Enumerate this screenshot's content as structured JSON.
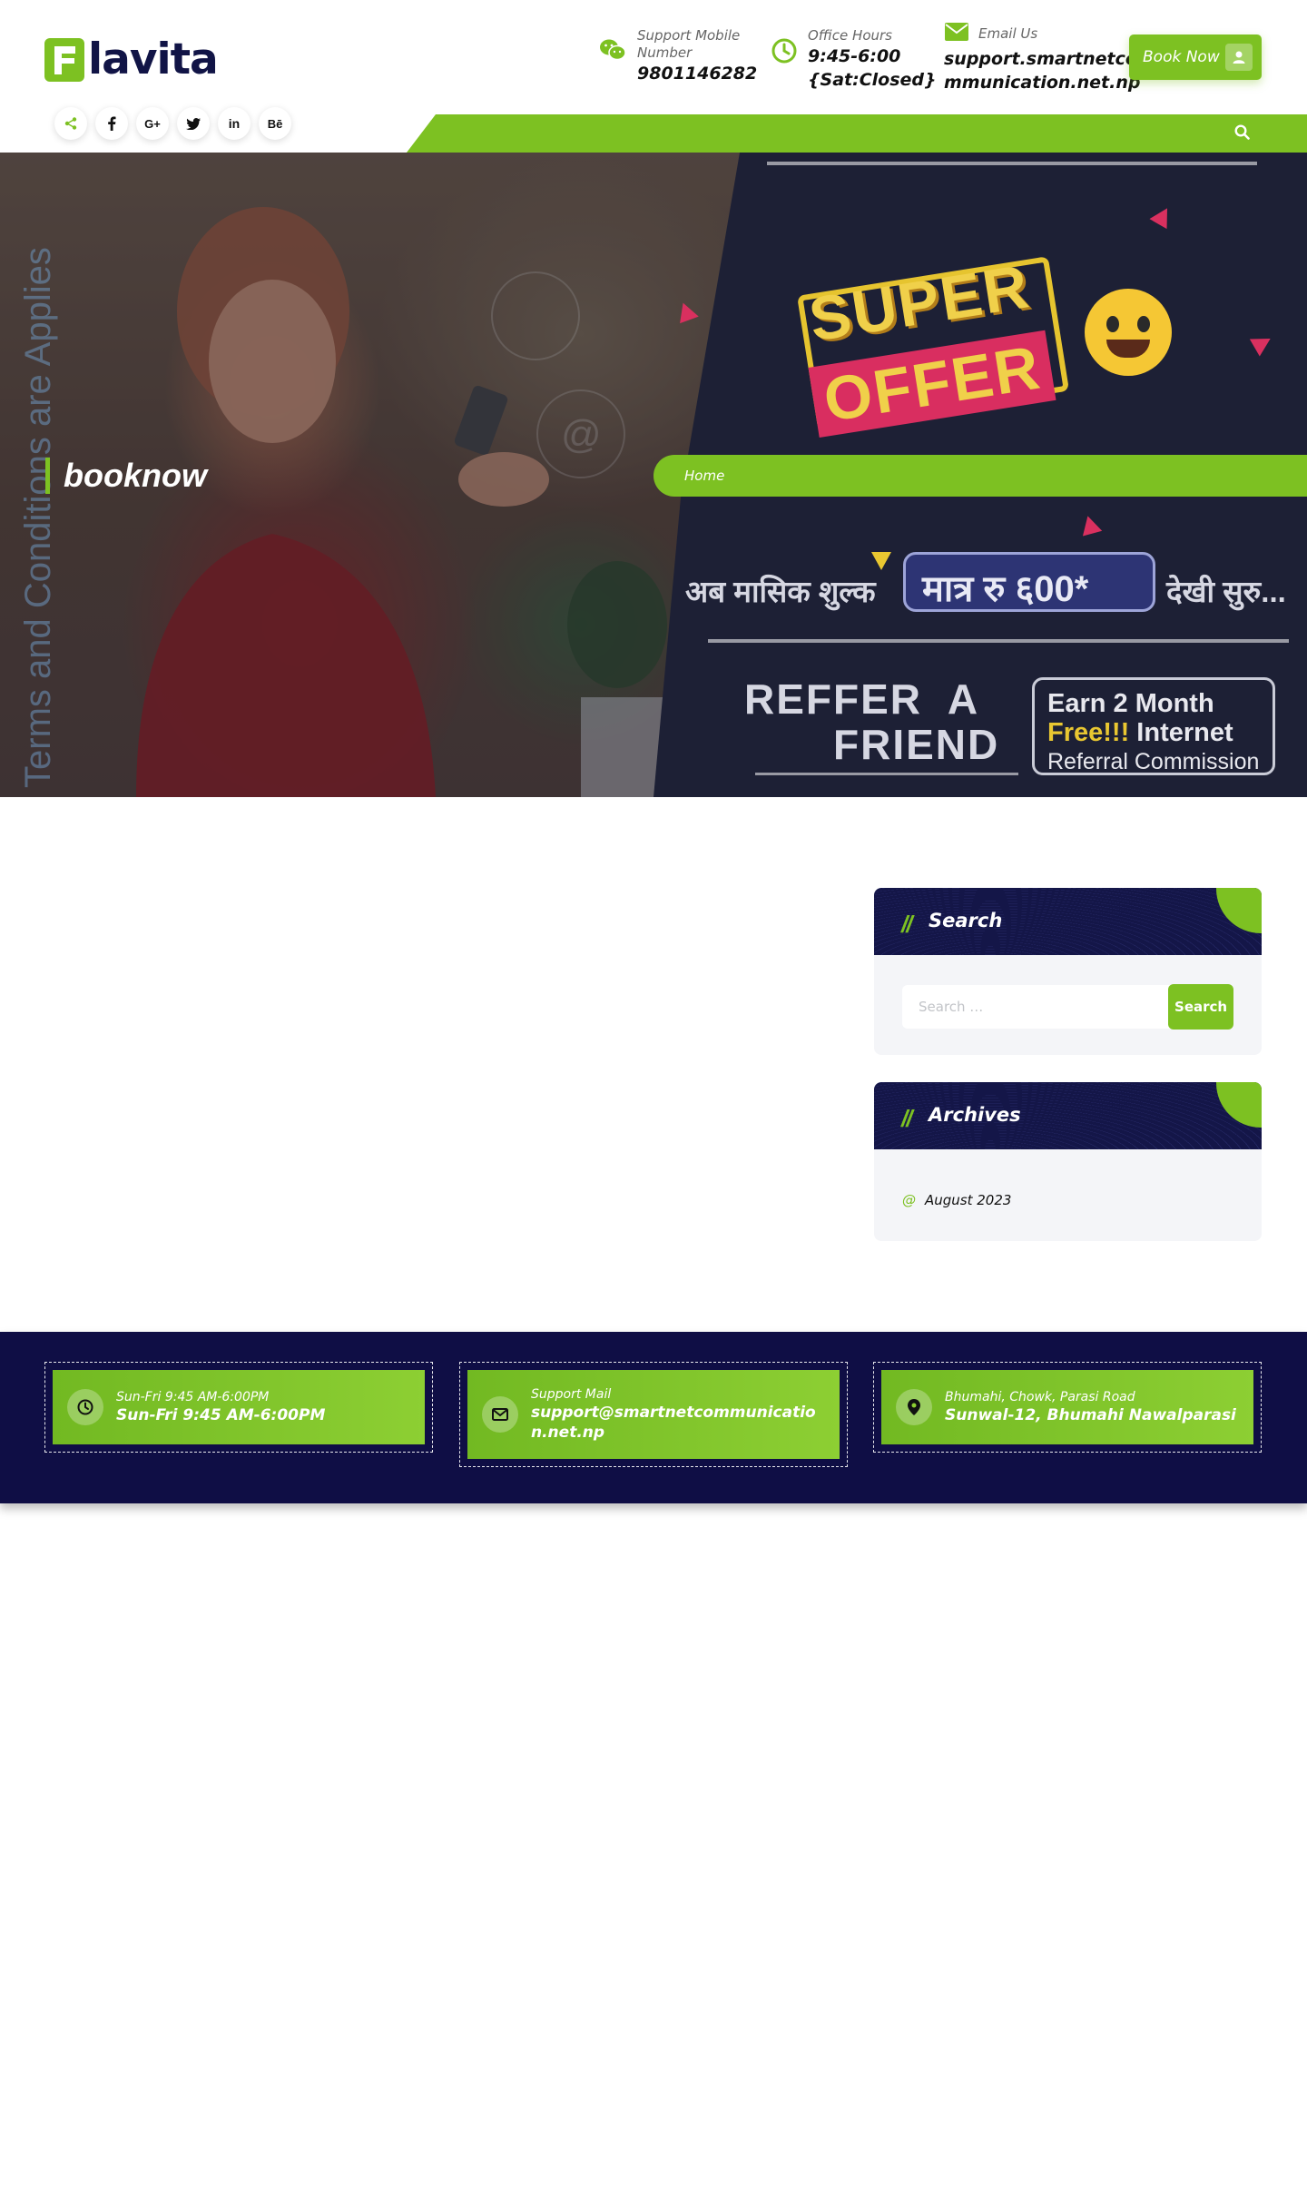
{
  "brand": {
    "name": "lavita",
    "accent": "#7dc122",
    "navy": "#111446"
  },
  "header": {
    "phone": {
      "label": "Support Mobile Number",
      "value": "9801146282",
      "icon": "wechat-icon"
    },
    "hours": {
      "label": "Office Hours",
      "value_line1": "9:45-6:00",
      "value_line2": "{Sat:Closed}",
      "icon": "clock-icon"
    },
    "email": {
      "label": "Email Us",
      "value_line1": "support.smartnetco",
      "value_line2": "mmunication.net.np",
      "icon": "envelope-icon"
    },
    "book_now": "Book Now"
  },
  "social": [
    {
      "name": "share",
      "glyph": "<"
    },
    {
      "name": "facebook",
      "glyph": "f"
    },
    {
      "name": "google-plus",
      "glyph": "G+"
    },
    {
      "name": "twitter",
      "glyph": "t"
    },
    {
      "name": "linkedin",
      "glyph": "in"
    },
    {
      "name": "behance",
      "glyph": "Bē"
    }
  ],
  "hero": {
    "page_title": "booknow",
    "breadcrumb_home": "Home",
    "banner": {
      "vertical_text": "Terms and Conditions are Applies",
      "super": "SUPER",
      "offer": "OFFER",
      "nepali_left": "अब मासिक शुल्क",
      "nepali_price": "मात्र रु ६00*",
      "nepali_right": "देखी सुरु...",
      "refer_line1": "REFFER  A",
      "refer_line2": "FRIEND",
      "earn_line1": "Earn 2 Month",
      "earn_free": "Free!!!",
      "earn_internet": " Internet",
      "earn_line3": "Referral Commission"
    }
  },
  "sidebar": {
    "search": {
      "title": "Search",
      "placeholder": "Search …",
      "button": "Search"
    },
    "archives": {
      "title": "Archives",
      "items": [
        "August 2023"
      ]
    }
  },
  "footer": {
    "cards": [
      {
        "small": "Sun-Fri 9:45 AM-6:00PM",
        "big": "Sun-Fri 9:45 AM-6:00PM",
        "icon": "clock-icon"
      },
      {
        "small": "Support Mail",
        "big": "support@smartnetcommunication.net.np",
        "icon": "envelope-icon"
      },
      {
        "small": "Bhumahi, Chowk, Parasi Road",
        "big": "Sunwal-12, Bhumahi Nawalparasi",
        "icon": "map-marker-icon"
      }
    ]
  }
}
